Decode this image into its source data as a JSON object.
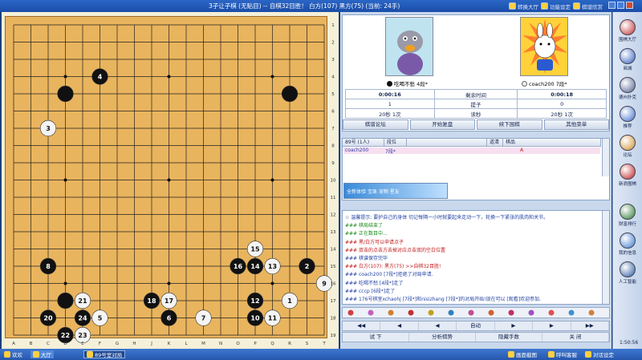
{
  "titlebar": {
    "title": "3子让子棋 (无贴目) -- 自棋32目胜！ 白方(107) 黑方(75) (当前: 24手)",
    "buttons": [
      "转换大厅",
      "功能设定",
      "棋谱欣赏"
    ]
  },
  "board": {
    "col_labels": [
      "A",
      "B",
      "C",
      "D",
      "E",
      "F",
      "G",
      "H",
      "J",
      "K",
      "L",
      "M",
      "N",
      "O",
      "P",
      "Q",
      "R",
      "S",
      "T"
    ],
    "row_labels": [
      "1",
      "2",
      "3",
      "4",
      "5",
      "6",
      "7",
      "8",
      "9",
      "10",
      "11",
      "12",
      "13",
      "14",
      "15",
      "16",
      "17",
      "18",
      "19"
    ],
    "hoshi": [
      [
        3,
        3
      ],
      [
        9,
        3
      ],
      [
        15,
        3
      ],
      [
        3,
        9
      ],
      [
        9,
        9
      ],
      [
        15,
        9
      ],
      [
        3,
        15
      ],
      [
        9,
        15
      ],
      [
        15,
        15
      ]
    ],
    "stones": [
      {
        "col": 5,
        "row": 3,
        "color": "black",
        "label": "4"
      },
      {
        "col": 3,
        "row": 4,
        "color": "black",
        "label": ""
      },
      {
        "col": 16,
        "row": 4,
        "color": "black",
        "label": ""
      },
      {
        "col": 2,
        "row": 6,
        "color": "white",
        "label": "3"
      },
      {
        "col": 14,
        "row": 13,
        "color": "white",
        "label": "15"
      },
      {
        "col": 2,
        "row": 14,
        "color": "black",
        "label": "8"
      },
      {
        "col": 13,
        "row": 14,
        "color": "black",
        "label": "16"
      },
      {
        "col": 14,
        "row": 14,
        "color": "black",
        "label": "14"
      },
      {
        "col": 15,
        "row": 14,
        "color": "white",
        "label": "13"
      },
      {
        "col": 17,
        "row": 14,
        "color": "black",
        "label": "2"
      },
      {
        "col": 18,
        "row": 15,
        "color": "white",
        "label": "9"
      },
      {
        "col": 3,
        "row": 16,
        "color": "black",
        "label": ""
      },
      {
        "col": 4,
        "row": 16,
        "color": "white",
        "label": "21"
      },
      {
        "col": 8,
        "row": 16,
        "color": "black",
        "label": "18"
      },
      {
        "col": 9,
        "row": 16,
        "color": "white",
        "label": "17"
      },
      {
        "col": 14,
        "row": 16,
        "color": "black",
        "label": "12"
      },
      {
        "col": 16,
        "row": 16,
        "color": "white",
        "label": "1"
      },
      {
        "col": 2,
        "row": 17,
        "color": "black",
        "label": "20"
      },
      {
        "col": 4,
        "row": 17,
        "color": "black",
        "label": "24"
      },
      {
        "col": 5,
        "row": 17,
        "color": "white",
        "label": "5"
      },
      {
        "col": 9,
        "row": 17,
        "color": "black",
        "label": "6"
      },
      {
        "col": 11,
        "row": 17,
        "color": "white",
        "label": "7"
      },
      {
        "col": 14,
        "row": 17,
        "color": "black",
        "label": "10"
      },
      {
        "col": 15,
        "row": 17,
        "color": "white",
        "label": "11"
      },
      {
        "col": 3,
        "row": 18,
        "color": "black",
        "label": "22"
      },
      {
        "col": 4,
        "row": 18,
        "color": "white",
        "label": "23"
      }
    ]
  },
  "players": {
    "black_name": "吃喝不愁 4段*",
    "white_name": "coach200 7段*",
    "black_time": "0:00:16",
    "remaining_label": "剩余时间",
    "white_time": "0:00:18",
    "black_captures": "1",
    "captures_label": "提子",
    "white_captures": "0",
    "black_byoyomi": "20秒 1次",
    "byoyomi_label": "读秒",
    "white_byoyomi": "20秒 1次"
  },
  "panel_buttons": [
    "棋谱论坛",
    "开始复盘",
    "续下围棋",
    "其他菜单"
  ],
  "room": {
    "headers": [
      "89号 (1人)",
      "段位",
      "",
      "道清",
      "棋品"
    ],
    "row": {
      "name": "coach200",
      "rank": "7段*",
      "grade": "A"
    },
    "ad_text": "全新体验 宝珠 宠物 星友"
  },
  "chat": [
    {
      "text": "☆ 温馨提示: 要护自己的身体 切记每隔一小时就要起来走动一下，轮换一下紧张的肌肉和关节。",
      "color": "#1f3fa0"
    },
    {
      "text": "### 棋局结束了",
      "color": "#1a8a1a"
    },
    {
      "text": "### 正在数目中...",
      "color": "#1a8a1a"
    },
    {
      "text": "### 黑/白方可以申请点子",
      "color": "#c01818"
    },
    {
      "text": "### 双击的点击方去掉对应点击双的空白位置",
      "color": "#c01818"
    },
    {
      "text": "### 棋谱保存完毕",
      "color": "#1f3fa0"
    },
    {
      "text": "### 白方(107): 黑方(75) >>自棋32目胜!",
      "color": "#c01818"
    },
    {
      "text": "### coach200 [7段*]拒绝了对局申请.",
      "color": "#1f3fa0"
    },
    {
      "text": "### 吃喝不愁 [4段*]走了",
      "color": "#1f3fa0"
    },
    {
      "text": "### cccp [6段*]走了",
      "color": "#1f3fa0"
    },
    {
      "text": "### 176号棋室xchaohj [7段*]和nisizhang [7段*]的对局开始!现在可以 [观看]欢迎参加.",
      "color": "#1f3fa0"
    }
  ],
  "controls_row1": [
    "◀◀",
    "◀",
    "◀",
    "自动",
    "▶",
    "▶",
    "▶▶"
  ],
  "controls_row2": [
    "试    下",
    "分析棋势",
    "隐藏手数",
    "关    闭"
  ],
  "sidebar": [
    "围棋大厅",
    "商城",
    "德州扑克",
    "推荐",
    "论坛",
    "新浪围棋",
    "财富排行",
    "我的信息",
    "人工智能"
  ],
  "clock": "1:50:56",
  "taskbar": [
    "欢欢",
    "大厅",
    "89号室对局",
    "画面截图",
    "呼叫客服",
    "对话设定"
  ],
  "colors": {
    "board": "#e9b45e",
    "frame": "#1b3f7a",
    "accent": "#2b66c6"
  }
}
